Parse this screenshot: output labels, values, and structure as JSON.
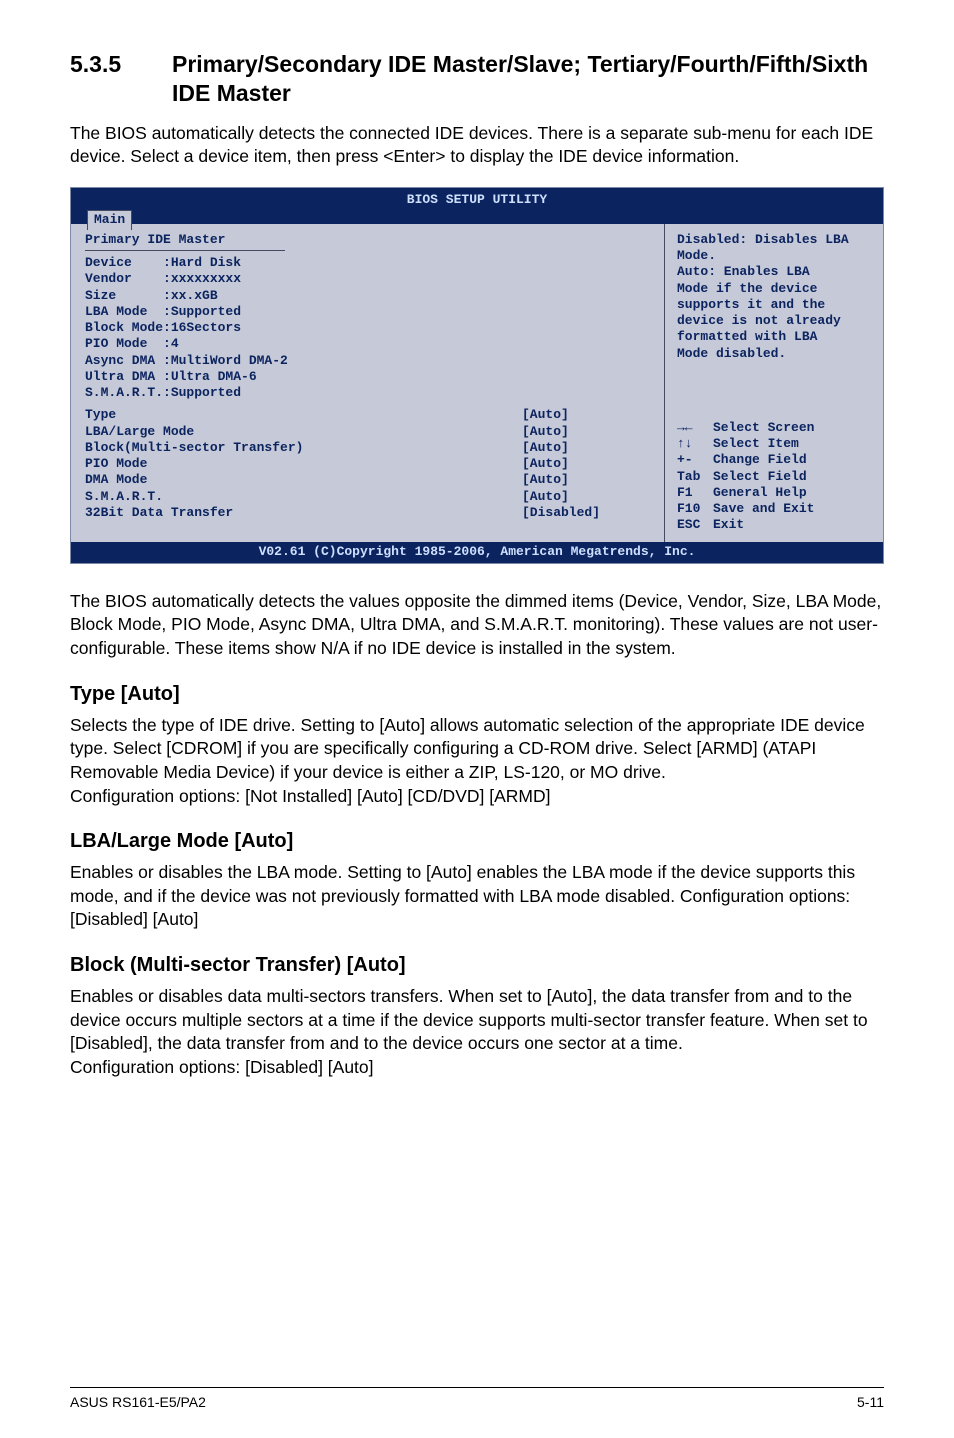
{
  "section": {
    "number": "5.3.5",
    "title": "Primary/Secondary IDE Master/Slave; Tertiary/Fourth/Fifth/Sixth IDE Master"
  },
  "intro": "The BIOS automatically detects the connected IDE devices. There is a separate sub-menu for each IDE device. Select a device item, then press <Enter> to display the IDE device information.",
  "bios": {
    "header_title": "BIOS SETUP UTILITY",
    "tab": "Main",
    "panel_title": "Primary IDE Master",
    "info_lines": [
      "Device    :Hard Disk",
      "Vendor    :xxxxxxxxx",
      "Size      :xx.xGB",
      "LBA Mode  :Supported",
      "Block Mode:16Sectors",
      "PIO Mode  :4",
      "Async DMA :MultiWord DMA-2",
      "Ultra DMA :Ultra DMA-6",
      "S.M.A.R.T.:Supported"
    ],
    "options": [
      {
        "label": "Type",
        "value": "[Auto]"
      },
      {
        "label": "LBA/Large Mode",
        "value": "[Auto]"
      },
      {
        "label": "Block(Multi-sector Transfer)",
        "value": "[Auto]"
      },
      {
        "label": "PIO Mode",
        "value": "[Auto]"
      },
      {
        "label": "DMA Mode",
        "value": "[Auto]"
      },
      {
        "label": "S.M.A.R.T.",
        "value": "[Auto]"
      },
      {
        "label": "32Bit Data Transfer",
        "value": "[Disabled]"
      }
    ],
    "help": [
      "Disabled: Disables LBA",
      "Mode.",
      "Auto: Enables LBA",
      "Mode if the device",
      "supports it and the",
      "device is not already",
      "formatted with LBA",
      "Mode disabled."
    ],
    "nav": [
      {
        "key": "→←",
        "label": "Select Screen"
      },
      {
        "key": "↑↓",
        "label": "Select Item"
      },
      {
        "key": "+-",
        "label": "Change Field"
      },
      {
        "key": "Tab",
        "label": "Select Field"
      },
      {
        "key": "F1",
        "label": "General Help"
      },
      {
        "key": "F10",
        "label": "Save and Exit"
      },
      {
        "key": "ESC",
        "label": "Exit"
      }
    ],
    "footer": "V02.61 (C)Copyright 1985-2006, American Megatrends, Inc."
  },
  "after_bios": "The BIOS automatically detects the values opposite the dimmed items (Device, Vendor, Size, LBA Mode, Block Mode, PIO Mode, Async DMA, Ultra DMA, and S.M.A.R.T. monitoring). These values are not user-configurable. These items show N/A if no IDE device is installed in the system.",
  "sub1": {
    "title": "Type [Auto]",
    "p1": "Selects the type of IDE drive. Setting to [Auto] allows automatic selection of the appropriate IDE device type. Select [CDROM] if you are specifically configuring a CD-ROM drive. Select [ARMD] (ATAPI Removable Media Device) if your device is either a ZIP, LS-120, or MO drive.",
    "p2": "Configuration options: [Not Installed] [Auto] [CD/DVD] [ARMD]"
  },
  "sub2": {
    "title": "LBA/Large Mode [Auto]",
    "p1": "Enables or disables the LBA mode. Setting to [Auto] enables the LBA mode if the device supports this mode, and if the device was not previously formatted with LBA mode disabled. Configuration options: [Disabled] [Auto]"
  },
  "sub3": {
    "title": "Block (Multi-sector Transfer) [Auto]",
    "p1": "Enables or disables data multi-sectors transfers. When set to [Auto], the data transfer from and to the device occurs multiple sectors at a time if the device supports multi-sector transfer feature. When set to [Disabled], the data transfer from and to the device occurs one sector at a time.",
    "p2": "Configuration options: [Disabled] [Auto]"
  },
  "footer": {
    "left": "ASUS RS161-E5/PA2",
    "right": "5-11"
  }
}
